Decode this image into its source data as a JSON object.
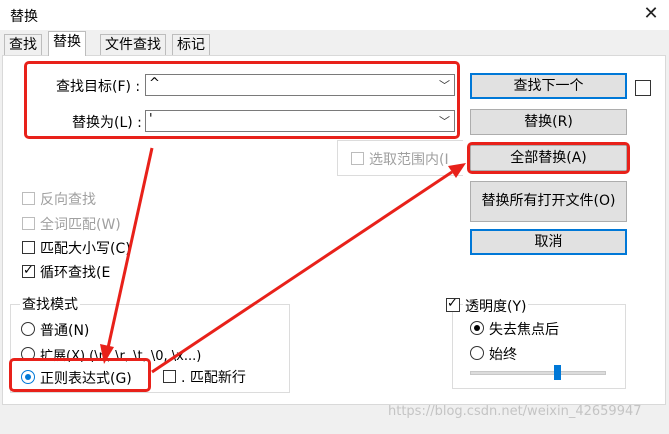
{
  "window": {
    "title": "替换",
    "close": "✕"
  },
  "tabs": [
    {
      "label": "查找",
      "active": false
    },
    {
      "label": "替换",
      "active": true
    },
    {
      "label": "文件查找",
      "active": false
    },
    {
      "label": "标记",
      "active": false
    }
  ],
  "find": {
    "label": "查找目标(F) :",
    "value": "^"
  },
  "replace": {
    "label": "替换为(L) :",
    "value": "'"
  },
  "in_selection": {
    "label": "选取范围内(I",
    "checked": false,
    "enabled": false
  },
  "buttons": {
    "find_next": "查找下一个",
    "replace": "替换(R)",
    "replace_all": "全部替换(A)",
    "replace_all_open": "替换所有打开文件(O)",
    "cancel": "取消"
  },
  "options": {
    "backward": "反向查找",
    "whole_word": "全词匹配(W)",
    "match_case": "匹配大小写(C)",
    "wrap": "循环查找(E"
  },
  "search_mode": {
    "title": "查找模式",
    "normal": "普通(N)",
    "extended": "扩展(X) (\\n, \\r, \\t, \\0, \\x...)",
    "regex": "正则表达式(G)",
    "dot_newline": ". 匹配新行",
    "selected": "regex"
  },
  "transparency": {
    "label": "透明度(Y)",
    "checked": true,
    "on_lose_focus": "失去焦点后",
    "always": "始终",
    "selected": "on_lose_focus",
    "level": 0.65
  },
  "watermark": "https://blog.csdn.net/weixin_42659947",
  "accent": "#0078d7",
  "highlight": "#e8211a"
}
